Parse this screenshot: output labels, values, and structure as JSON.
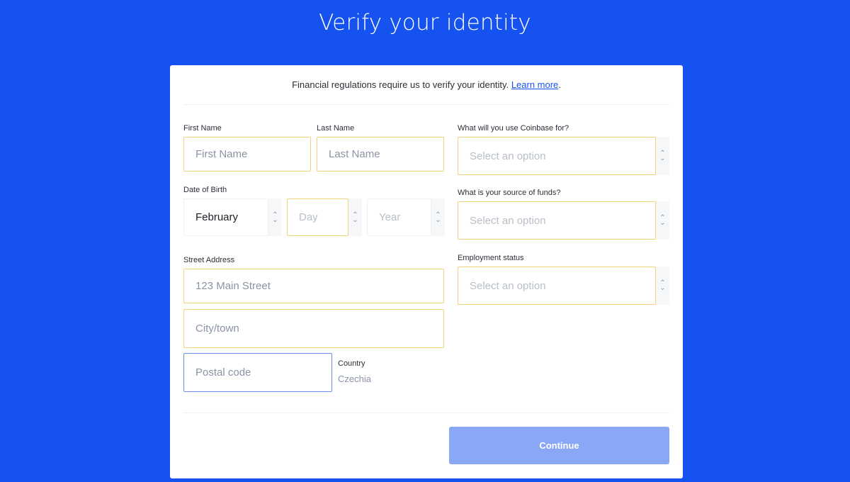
{
  "header": {
    "title": "Verify your identity"
  },
  "intro": {
    "text": "Financial regulations require us to verify your identity. ",
    "link": "Learn more",
    "suffix": "."
  },
  "form": {
    "first_name": {
      "label": "First Name",
      "placeholder": "First Name"
    },
    "last_name": {
      "label": "Last Name",
      "placeholder": "Last Name"
    },
    "dob": {
      "label": "Date of Birth",
      "month": "February",
      "day_placeholder": "Day",
      "year_placeholder": "Year"
    },
    "street": {
      "label": "Street Address",
      "placeholder": "123 Main Street"
    },
    "city": {
      "placeholder": "City/town"
    },
    "postal": {
      "placeholder": "Postal code"
    },
    "country": {
      "label": "Country",
      "value": "Czechia"
    },
    "usage": {
      "label": "What will you use Coinbase for?",
      "placeholder": "Select an option"
    },
    "funds": {
      "label": "What is your source of funds?",
      "placeholder": "Select an option"
    },
    "employment": {
      "label": "Employment status",
      "placeholder": "Select an option"
    }
  },
  "actions": {
    "continue_label": "Continue"
  },
  "colors": {
    "brand": "#1652f0",
    "button_disabled": "#8aa7f6",
    "field_border": "#f2d27a",
    "focus_border": "#6d8ee8"
  }
}
